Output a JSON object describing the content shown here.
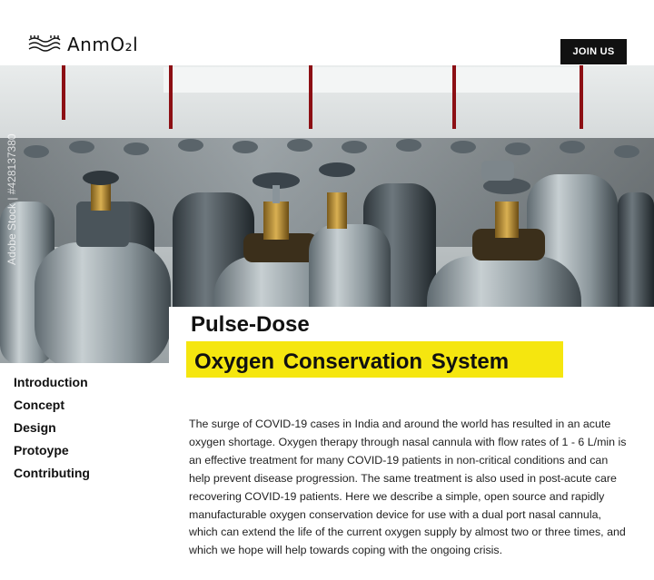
{
  "header": {
    "logo_text": "AnmO₂l",
    "join_label": "JOIN US"
  },
  "hero": {
    "watermark": "Adobe Stock | #428137380"
  },
  "title": {
    "line1": "Pulse-Dose",
    "line2": "Oxygen Conservation System",
    "highlight_color": "#f5e60f"
  },
  "nav": {
    "items": [
      {
        "label": "Introduction"
      },
      {
        "label": "Concept"
      },
      {
        "label": "Design"
      },
      {
        "label": "Protoype"
      },
      {
        "label": "Contributing"
      }
    ]
  },
  "content": {
    "paragraph": "The surge of COVID-19 cases in India and around the world has resulted in an acute oxygen shortage. Oxygen therapy through nasal cannula with flow rates of 1 - 6 L/min is an effective treatment for many COVID-19 patients in non-critical conditions and can help prevent disease progression. The same treatment is also used in post-acute care recovering COVID-19 patients. Here we describe a simple, open source and rapidly manufacturable oxygen conservation device for use with a dual port nasal cannula, which can extend the life of the current oxygen supply by almost two or three times, and which we hope will help towards coping with the ongoing crisis."
  }
}
